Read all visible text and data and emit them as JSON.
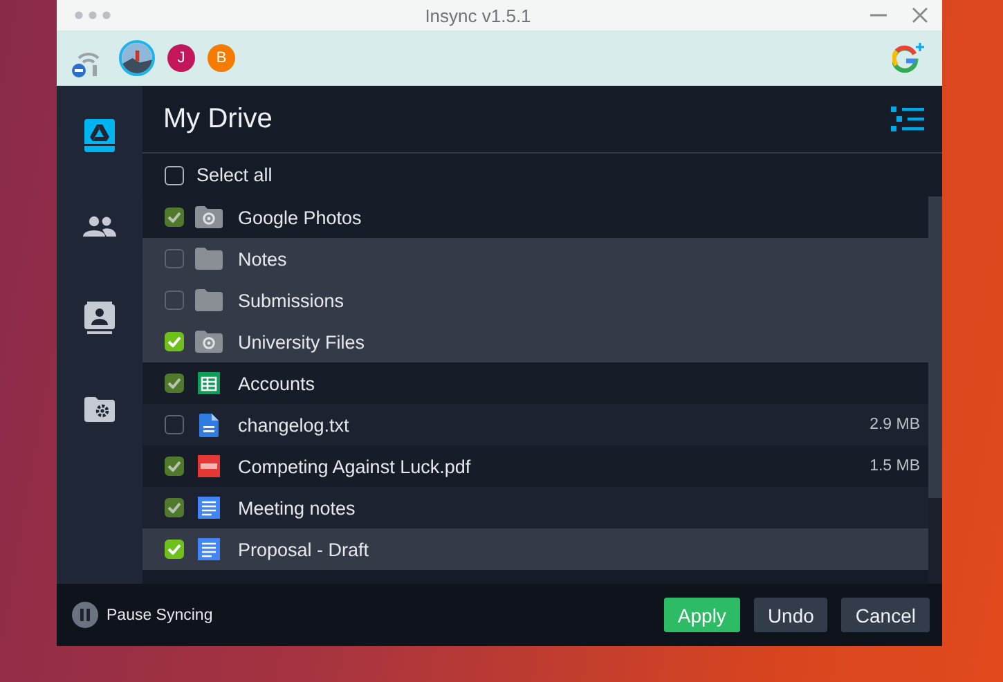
{
  "window": {
    "title": "Insync v1.5.1"
  },
  "accounts": [
    {
      "kind": "photo",
      "selected": true
    },
    {
      "kind": "letter",
      "initial": "J",
      "color": "#c2185b",
      "selected": false
    },
    {
      "kind": "letter",
      "initial": "B",
      "color": "#f57c00",
      "selected": false
    }
  ],
  "sidebar": {
    "items": [
      {
        "kind": "drive",
        "selected": true
      },
      {
        "kind": "people",
        "selected": false
      },
      {
        "kind": "contacts",
        "selected": false
      },
      {
        "kind": "folder-gear",
        "selected": false
      }
    ]
  },
  "header": {
    "title": "My Drive"
  },
  "select_all": {
    "label": "Select all",
    "checked": false
  },
  "files": [
    {
      "kind": "shared-folder",
      "name": "Google Photos",
      "checked": true,
      "selected": false
    },
    {
      "kind": "folder",
      "name": "Notes",
      "checked": false,
      "selected": true
    },
    {
      "kind": "folder",
      "name": "Submissions",
      "checked": false,
      "selected": true
    },
    {
      "kind": "shared-folder",
      "name": "University Files",
      "checked": true,
      "selected": true
    },
    {
      "kind": "sheet",
      "name": "Accounts",
      "checked": true,
      "selected": false
    },
    {
      "kind": "text",
      "name": "changelog.txt",
      "size": "2.9 MB",
      "checked": false,
      "selected": false
    },
    {
      "kind": "pdf",
      "name": "Competing Against Luck.pdf",
      "size": "1.5 MB",
      "checked": true,
      "selected": false
    },
    {
      "kind": "doc",
      "name": "Meeting notes",
      "checked": true,
      "selected": false
    },
    {
      "kind": "doc",
      "name": "Proposal - Draft",
      "checked": true,
      "selected": true
    }
  ],
  "footer": {
    "pause_label": "Pause Syncing",
    "buttons": [
      {
        "label": "Apply",
        "kind": "primary"
      },
      {
        "label": "Undo",
        "kind": "secondary"
      },
      {
        "label": "Cancel",
        "kind": "secondary"
      }
    ]
  }
}
